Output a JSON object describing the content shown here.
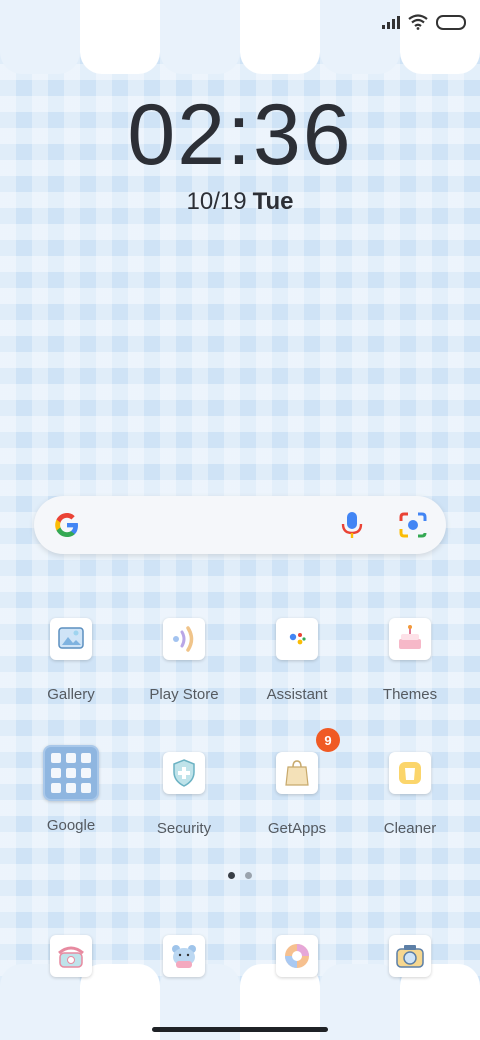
{
  "status": {
    "signal_icon": "signal-bars-icon",
    "wifi_icon": "wifi-icon",
    "battery_icon": "battery-icon"
  },
  "clock": {
    "time": "02:36",
    "date": "10/19",
    "weekday": "Tue"
  },
  "search": {
    "google_icon": "google-g-icon",
    "mic_icon": "microphone-icon",
    "lens_icon": "google-lens-icon"
  },
  "apps": [
    {
      "label": "Gallery",
      "icon": "gallery-icon"
    },
    {
      "label": "Play Store",
      "icon": "play-store-icon"
    },
    {
      "label": "Assistant",
      "icon": "assistant-icon"
    },
    {
      "label": "Themes",
      "icon": "themes-cake-icon"
    },
    {
      "label": "Google",
      "icon": "folder-icon"
    },
    {
      "label": "Security",
      "icon": "security-shield-icon"
    },
    {
      "label": "GetApps",
      "icon": "getapps-bag-icon",
      "badge": "9"
    },
    {
      "label": "Cleaner",
      "icon": "cleaner-bin-icon"
    }
  ],
  "pages": {
    "count": 2,
    "current": 1
  },
  "dock": [
    {
      "icon": "phone-icon"
    },
    {
      "icon": "messages-bear-icon"
    },
    {
      "icon": "browser-icon"
    },
    {
      "icon": "camera-icon"
    }
  ],
  "colors": {
    "background": "#cfe3f6",
    "badge": "#f05a24",
    "text": "#2c2f36"
  }
}
